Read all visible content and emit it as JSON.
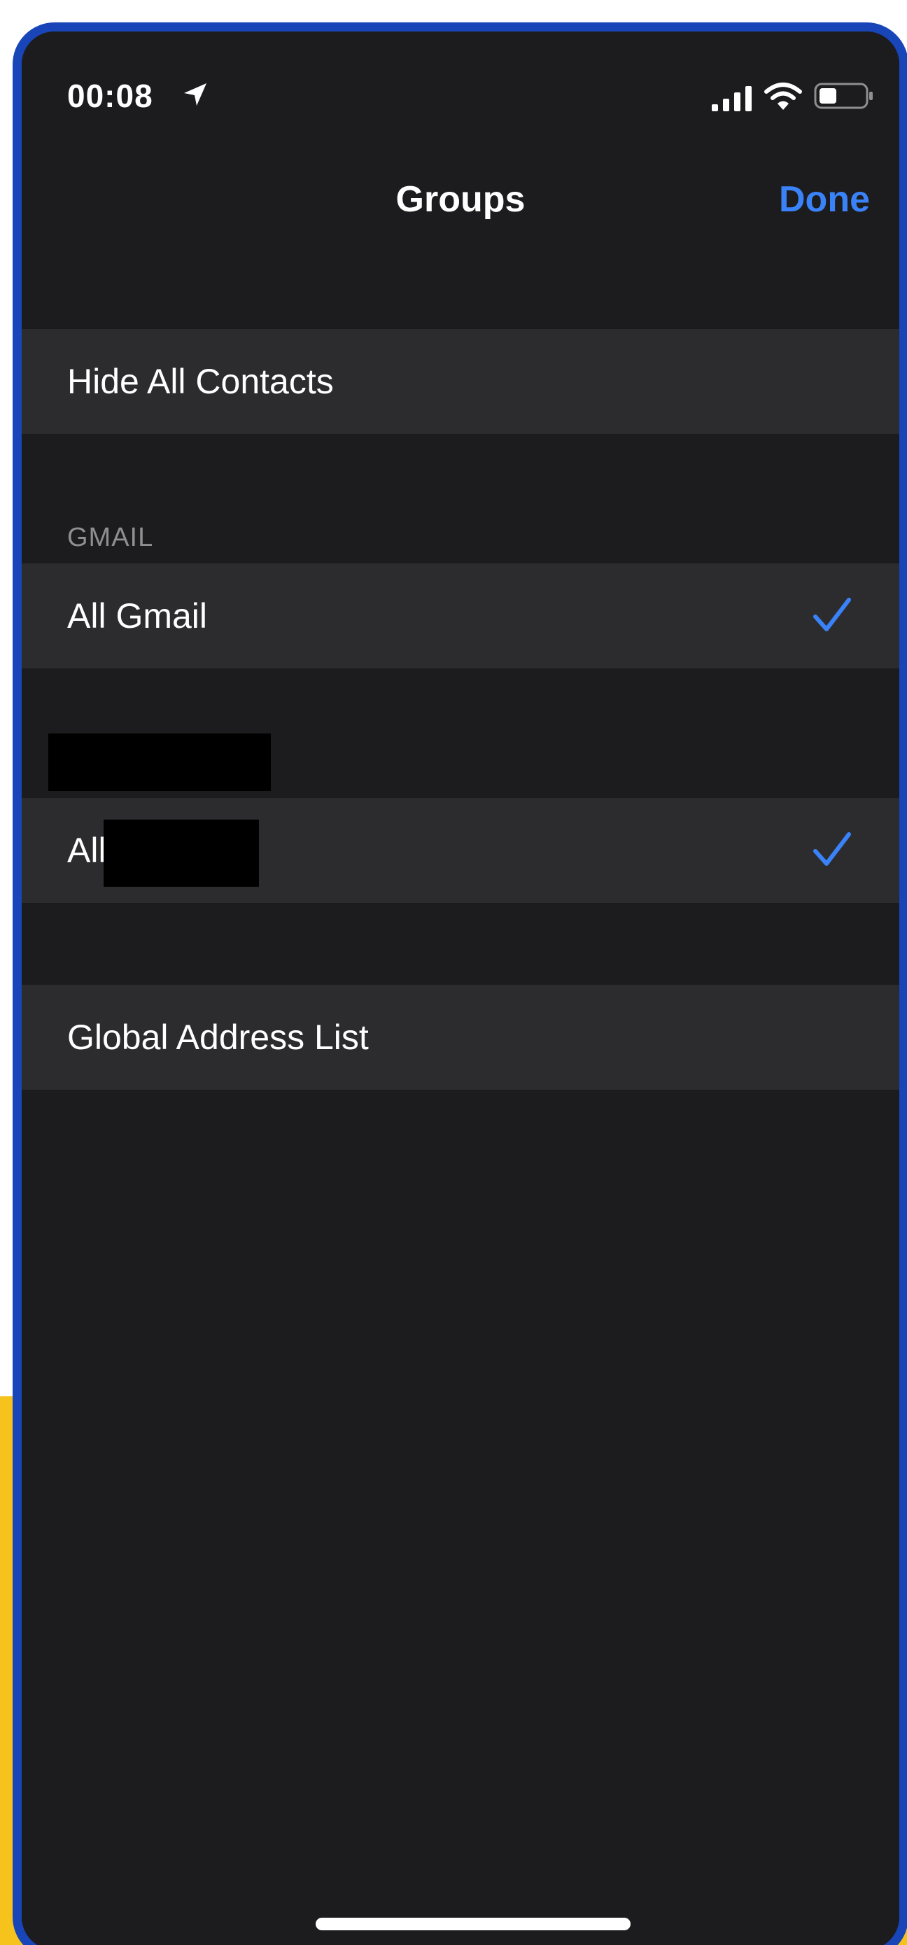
{
  "status_bar": {
    "time": "00:08",
    "icons": [
      "location-arrow-icon",
      "cellular-signal-icon",
      "wifi-icon",
      "battery-icon"
    ]
  },
  "nav": {
    "title": "Groups",
    "done_label": "Done"
  },
  "rows": {
    "hide_all": {
      "label": "Hide All Contacts"
    },
    "gmail_header": "GMAIL",
    "all_gmail": {
      "label": "All Gmail",
      "checked": true
    },
    "account2_all": {
      "label": "All",
      "checked": true
    },
    "global_address_list": {
      "label": "Global Address List"
    }
  },
  "colors": {
    "accent": "#3a82f7",
    "background": "#1c1c1e",
    "cell": "#2c2c2e",
    "frame": "#1846b8",
    "outer_accent": "#f6c21c",
    "section_header": "#8e8e93"
  }
}
